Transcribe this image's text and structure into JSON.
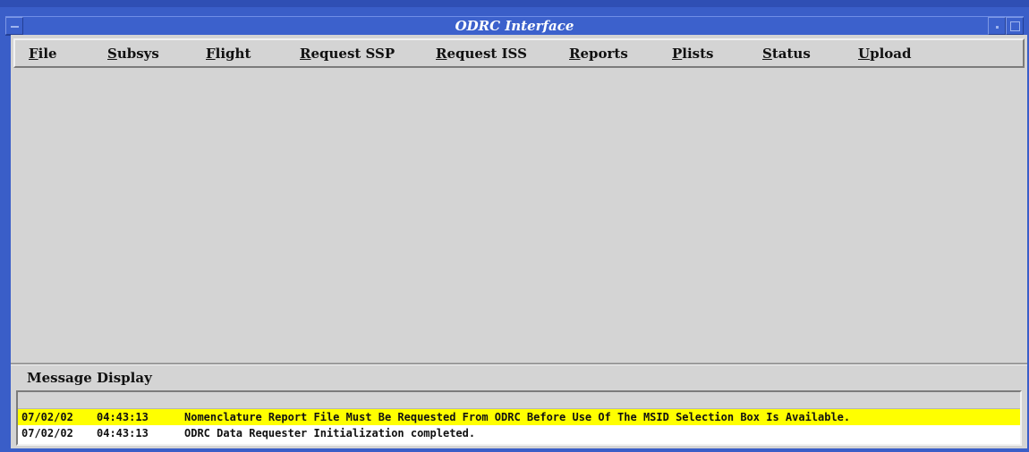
{
  "window": {
    "title": "ODRC Interface"
  },
  "colors": {
    "titlebar": "#3c61cc",
    "highlight": "#ffff00",
    "background": "#d4d4d4"
  },
  "menubar": {
    "items": [
      {
        "label": "File"
      },
      {
        "label": "Subsys"
      },
      {
        "label": "Flight"
      },
      {
        "label": "Request SSP"
      },
      {
        "label": "Request ISS"
      },
      {
        "label": "Reports"
      },
      {
        "label": "Plists"
      },
      {
        "label": "Status"
      },
      {
        "label": "Upload"
      }
    ]
  },
  "messages": {
    "label": "Message Display",
    "rows": [
      {
        "date": "07/02/02",
        "time": "04:43:13",
        "text": "Nomenclature Report File Must Be Requested From ODRC Before Use Of The MSID Selection Box Is Available.",
        "highlight": true
      },
      {
        "date": "07/02/02",
        "time": "04:43:13",
        "text": "ODRC Data Requester Initialization completed.",
        "highlight": false
      }
    ]
  }
}
